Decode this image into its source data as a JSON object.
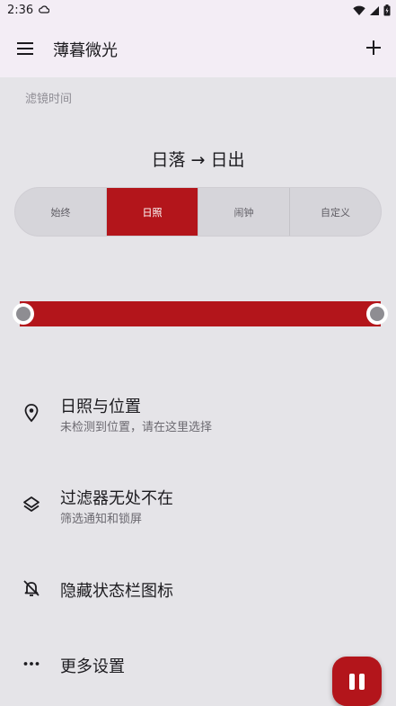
{
  "status_bar": {
    "time": "2:36"
  },
  "app_bar": {
    "title": "薄暮微光"
  },
  "section_label": "滤镜时间",
  "schedule_title": "日落 → 日出",
  "segments": [
    {
      "label": "始终",
      "active": false
    },
    {
      "label": "日照",
      "active": true
    },
    {
      "label": "闹钟",
      "active": false
    },
    {
      "label": "自定义",
      "active": false
    }
  ],
  "slider": {
    "start": 0,
    "end": 1
  },
  "settings": [
    {
      "label": "日照与位置",
      "sub": "未检测到位置，请在这里选择",
      "icon": "location-pin-icon"
    },
    {
      "label": "过滤器无处不在",
      "sub": "筛选通知和锁屏",
      "icon": "layers-icon"
    },
    {
      "label": "隐藏状态栏图标",
      "icon": "notifications-off-icon"
    },
    {
      "label": "更多设置",
      "icon": "more-horizontal-icon"
    }
  ],
  "colors": {
    "accent": "#b3151b",
    "background": "#e5e4e8",
    "appbar": "#f3edf5"
  },
  "fab": {
    "icon": "pause-icon"
  }
}
